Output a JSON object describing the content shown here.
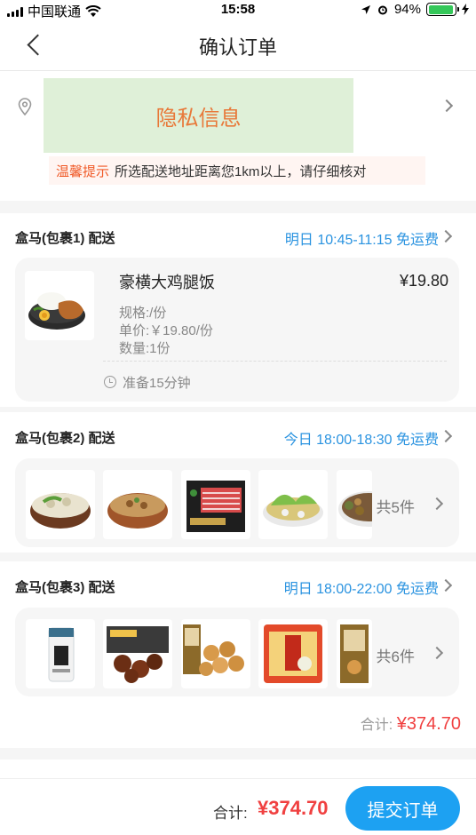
{
  "status_bar": {
    "carrier": "中国联通",
    "time": "15:58",
    "battery": "94%",
    "battery_level": 0.94
  },
  "nav": {
    "title": "确认订单",
    "back_icon": "chevron-left-icon"
  },
  "address": {
    "privacy_text": "隐私信息",
    "tip_label": "温馨提示",
    "tip_text": "所选配送地址距离您1km以上，请仔细核对"
  },
  "packages": [
    {
      "title": "盒马(包裹1) 配送",
      "delivery": "明日  10:45-11:15 免运费",
      "product": {
        "name": "豪横大鸡腿饭",
        "price": "¥19.80",
        "spec": "规格:/份",
        "unit_price": "单价:￥19.80/份",
        "qty": "数量:1份",
        "prep": "准备15分钟"
      }
    },
    {
      "title": "盒马(包裹2) 配送",
      "delivery": "今日  18:00-18:30 免运费",
      "count": "共5件"
    },
    {
      "title": "盒马(包裹3) 配送",
      "delivery": "明日  18:00-22:00 免运费",
      "count": "共6件"
    }
  ],
  "subtotal": {
    "label": "合计:",
    "amount": "¥374.70"
  },
  "bottom": {
    "label": "合计:",
    "amount": "¥374.70",
    "submit": "提交订单"
  },
  "colors": {
    "accent": "#1da1f2",
    "price": "#f04040",
    "delivery": "#2a93e0",
    "tip": "#f05a28"
  }
}
